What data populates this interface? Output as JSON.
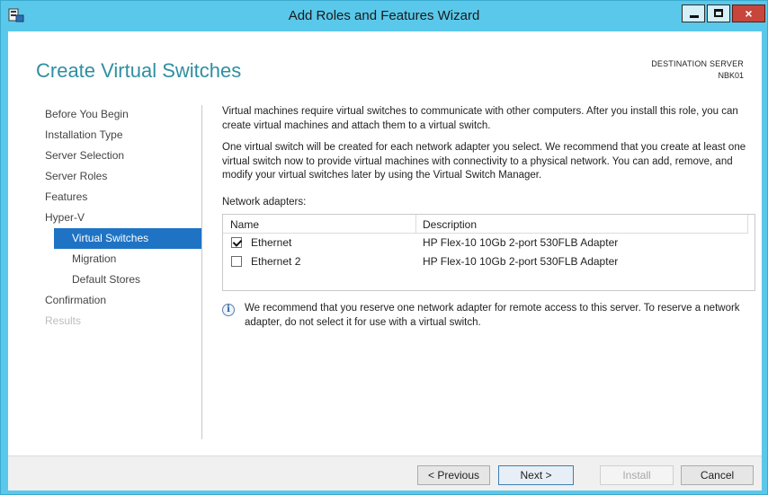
{
  "window": {
    "title": "Add Roles and Features Wizard",
    "close_glyph": "×",
    "accent_color": "#5ac8ea"
  },
  "header": {
    "page_title": "Create Virtual Switches",
    "destination_label": "DESTINATION SERVER",
    "destination_server": "NBK01"
  },
  "nav": {
    "items": [
      {
        "label": "Before You Begin",
        "state": "normal"
      },
      {
        "label": "Installation Type",
        "state": "normal"
      },
      {
        "label": "Server Selection",
        "state": "normal"
      },
      {
        "label": "Server Roles",
        "state": "normal"
      },
      {
        "label": "Features",
        "state": "normal"
      },
      {
        "label": "Hyper-V",
        "state": "normal"
      },
      {
        "label": "Virtual Switches",
        "state": "active"
      },
      {
        "label": "Migration",
        "state": "normal"
      },
      {
        "label": "Default Stores",
        "state": "normal"
      },
      {
        "label": "Confirmation",
        "state": "normal"
      },
      {
        "label": "Results",
        "state": "disabled"
      }
    ]
  },
  "content": {
    "para1": "Virtual machines require virtual switches to communicate with other computers. After you install this role, you can create virtual machines and attach them to a virtual switch.",
    "para2": "One virtual switch will be created for each network adapter you select. We recommend that you create at least one virtual switch now to provide virtual machines with connectivity to a physical network. You can add, remove, and modify your virtual switches later by using the Virtual Switch Manager.",
    "adapters_label": "Network adapters:",
    "columns": {
      "name": "Name",
      "description": "Description"
    },
    "adapters": [
      {
        "name": "Ethernet",
        "description": "HP Flex-10 10Gb 2-port 530FLB Adapter",
        "checked": true
      },
      {
        "name": "Ethernet 2",
        "description": "HP Flex-10 10Gb 2-port 530FLB Adapter",
        "checked": false
      }
    ],
    "info_icon_glyph": "i",
    "info_text": "We recommend that you reserve one network adapter for remote access to this server. To reserve a network adapter, do not select it for use with a virtual switch."
  },
  "footer": {
    "previous": "< Previous",
    "next": "Next >",
    "install": "Install",
    "cancel": "Cancel"
  }
}
